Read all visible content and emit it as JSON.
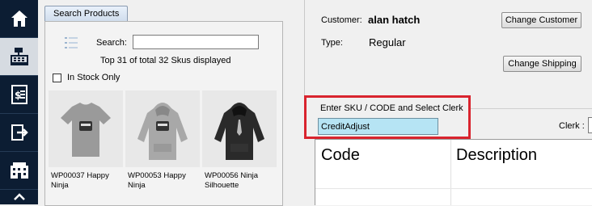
{
  "nav": {
    "items": [
      {
        "icon": "home-icon"
      },
      {
        "icon": "cash-register-icon"
      },
      {
        "icon": "receipt-icon"
      },
      {
        "icon": "exit-icon"
      },
      {
        "icon": "building-icon"
      }
    ]
  },
  "products_panel": {
    "tab_label": "Search Products",
    "search_label": "Search:",
    "search_value": "",
    "count_text": "Top 31 of total 32 Skus displayed",
    "in_stock_label": "In Stock Only",
    "in_stock_checked": false,
    "products": [
      {
        "label": "WP00037 Happy Ninja",
        "image": "tshirt-image"
      },
      {
        "label": "WP00053 Happy Ninja",
        "image": "hoodie-grey-image"
      },
      {
        "label": "WP00056 Ninja Silhouette",
        "image": "hoodie-black-image"
      }
    ]
  },
  "customer": {
    "customer_label": "Customer:",
    "customer_name": "alan hatch",
    "type_label": "Type:",
    "type_value": "Regular",
    "change_customer_label": "Change Customer",
    "change_shipping_label": "Change Shipping"
  },
  "entry": {
    "sku_label": "Enter SKU / CODE and Select Clerk",
    "sku_value": "CreditAdjust",
    "clerk_label": "Clerk :"
  },
  "grid": {
    "columns": [
      "Code",
      "Description"
    ]
  },
  "colors": {
    "nav_bg": "#0c1d33",
    "highlight_red": "#d9242e",
    "sku_input_bg": "#b6e4f4"
  }
}
